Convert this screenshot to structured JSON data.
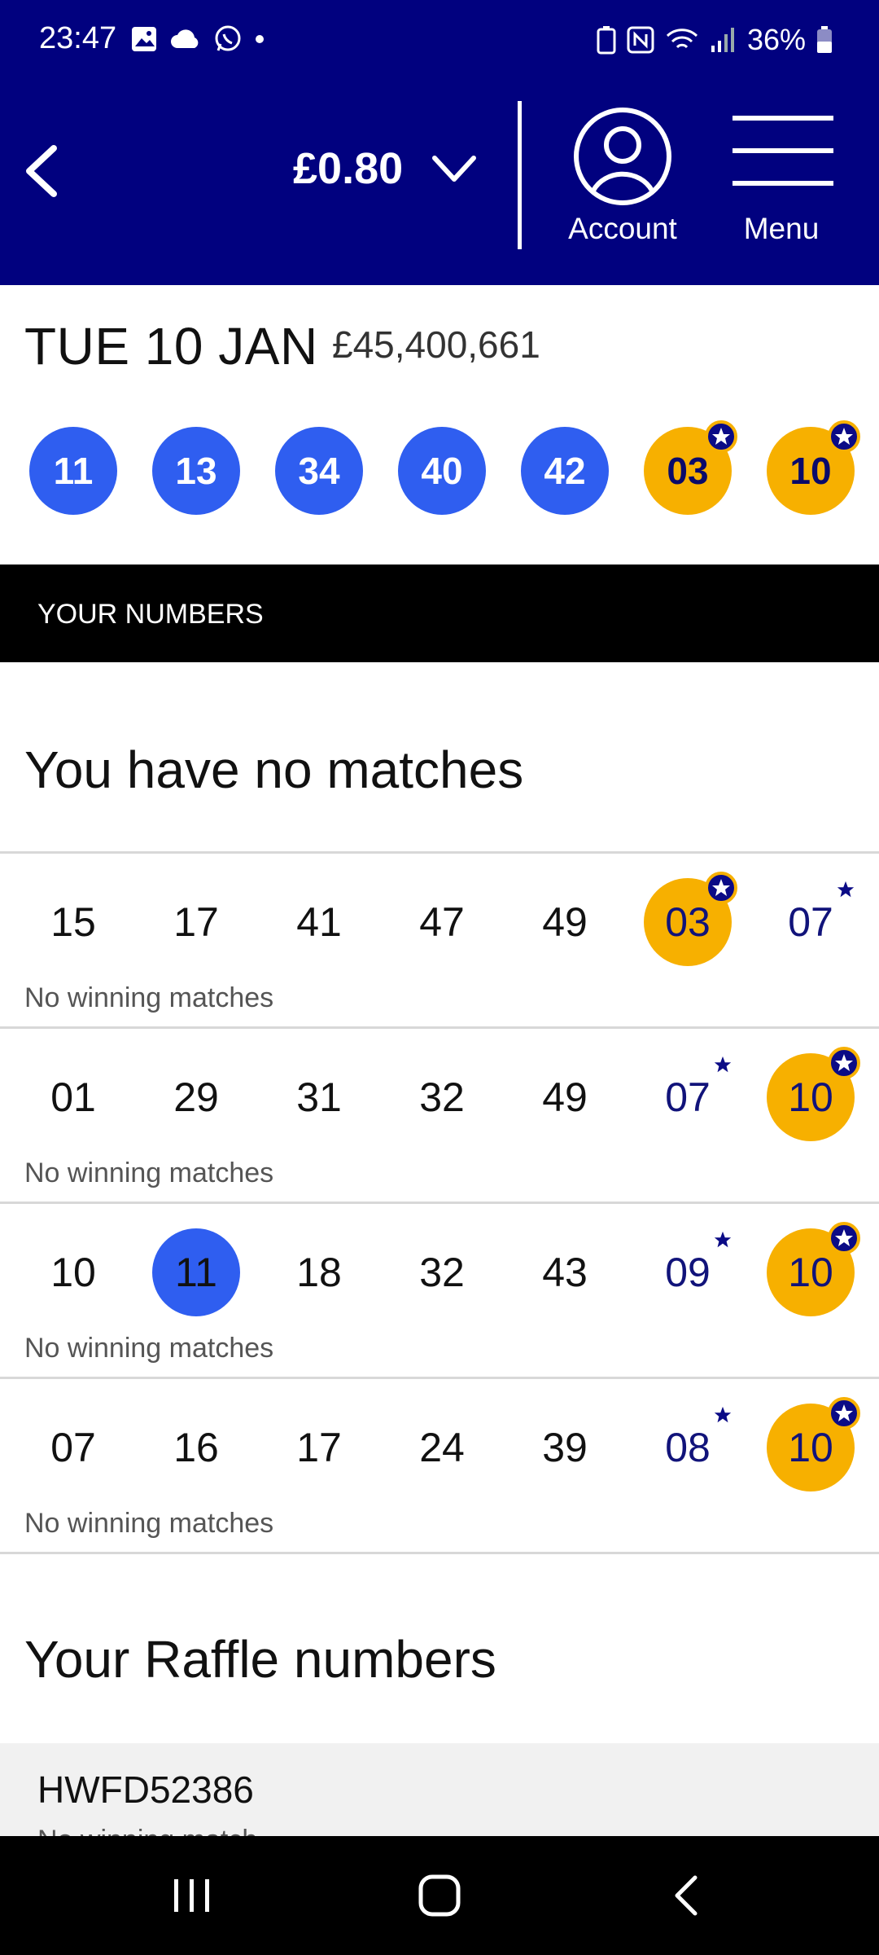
{
  "status": {
    "time": "23:47",
    "battery": "36%"
  },
  "header": {
    "balance": "£0.80",
    "account_label": "Account",
    "menu_label": "Menu"
  },
  "draw": {
    "date": "TUE 10 JAN",
    "jackpot": "£45,400,661",
    "main_numbers": [
      "11",
      "13",
      "34",
      "40",
      "42"
    ],
    "lucky_stars": [
      "03",
      "10"
    ]
  },
  "section": {
    "your_numbers": "YOUR NUMBERS"
  },
  "matches_heading": "You have no matches",
  "lines": [
    {
      "main": [
        "15",
        "17",
        "41",
        "47",
        "49"
      ],
      "stars": [
        "03",
        "07"
      ],
      "hit_main": [],
      "hit_star": [
        0
      ],
      "result": "No winning matches"
    },
    {
      "main": [
        "01",
        "29",
        "31",
        "32",
        "49"
      ],
      "stars": [
        "07",
        "10"
      ],
      "hit_main": [],
      "hit_star": [
        1
      ],
      "result": "No winning matches"
    },
    {
      "main": [
        "10",
        "11",
        "18",
        "32",
        "43"
      ],
      "stars": [
        "09",
        "10"
      ],
      "hit_main": [
        1
      ],
      "hit_star": [
        1
      ],
      "result": "No winning matches"
    },
    {
      "main": [
        "07",
        "16",
        "17",
        "24",
        "39"
      ],
      "stars": [
        "08",
        "10"
      ],
      "hit_main": [],
      "hit_star": [
        1
      ],
      "result": "No winning matches"
    }
  ],
  "raffle": {
    "heading": "Your Raffle numbers",
    "code": "HWFD52386",
    "status": "No winning match"
  },
  "colors": {
    "header_bg": "#01017f",
    "main_ball": "#2f5ef0",
    "star_ball": "#f7b000"
  },
  "icons": [
    "back-chevron-icon",
    "dropdown-chevron-icon",
    "account-icon",
    "menu-hamburger-icon",
    "recents-icon",
    "home-icon",
    "nav-back-icon"
  ]
}
